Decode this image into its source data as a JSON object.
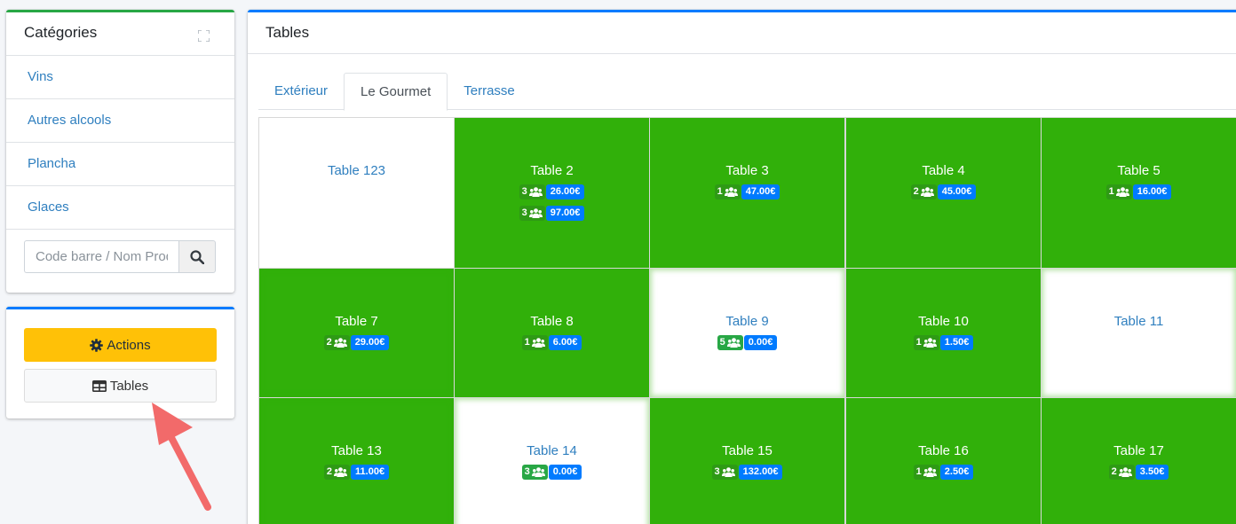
{
  "categories": {
    "title": "Catégories",
    "items": [
      "Vins",
      "Autres alcools",
      "Plancha",
      "Glaces"
    ],
    "search_placeholder": "Code barre / Nom Produit"
  },
  "actions": {
    "actions_label": "Actions",
    "tables_label": "Tables"
  },
  "tables_panel": {
    "title": "Tables",
    "tabs": [
      "Extérieur",
      "Le Gourmet",
      "Terrasse"
    ],
    "active_tab": "Le Gourmet",
    "tables": [
      {
        "name": "Table 123",
        "status": "free",
        "orders": []
      },
      {
        "name": "Table 2",
        "status": "busy",
        "orders": [
          {
            "covers": "3",
            "amount": "26.00€"
          },
          {
            "covers": "3",
            "amount": "97.00€"
          }
        ]
      },
      {
        "name": "Table 3",
        "status": "busy",
        "orders": [
          {
            "covers": "1",
            "amount": "47.00€"
          }
        ]
      },
      {
        "name": "Table 4",
        "status": "busy",
        "orders": [
          {
            "covers": "2",
            "amount": "45.00€"
          }
        ]
      },
      {
        "name": "Table 5",
        "status": "busy",
        "orders": [
          {
            "covers": "1",
            "amount": "16.00€"
          }
        ]
      },
      {
        "name": "Table 7",
        "status": "busy",
        "orders": [
          {
            "covers": "2",
            "amount": "29.00€"
          }
        ]
      },
      {
        "name": "Table 8",
        "status": "busy",
        "orders": [
          {
            "covers": "1",
            "amount": "6.00€"
          }
        ]
      },
      {
        "name": "Table 9",
        "status": "free",
        "orders": [
          {
            "covers": "5",
            "amount": "0.00€"
          }
        ]
      },
      {
        "name": "Table 10",
        "status": "busy",
        "orders": [
          {
            "covers": "1",
            "amount": "1.50€"
          }
        ]
      },
      {
        "name": "Table 11",
        "status": "free",
        "orders": []
      },
      {
        "name": "Table 13",
        "status": "busy",
        "orders": [
          {
            "covers": "2",
            "amount": "11.00€"
          }
        ]
      },
      {
        "name": "Table 14",
        "status": "free",
        "orders": [
          {
            "covers": "3",
            "amount": "0.00€"
          }
        ]
      },
      {
        "name": "Table 15",
        "status": "busy",
        "orders": [
          {
            "covers": "3",
            "amount": "132.00€"
          }
        ]
      },
      {
        "name": "Table 16",
        "status": "busy",
        "orders": [
          {
            "covers": "1",
            "amount": "2.50€"
          }
        ]
      },
      {
        "name": "Table 17",
        "status": "busy",
        "orders": [
          {
            "covers": "2",
            "amount": "3.50€"
          }
        ]
      }
    ]
  },
  "colors": {
    "busy": "#31b00a",
    "amount_badge": "#007bff",
    "actions_button": "#ffc107",
    "link": "#2f7fbf",
    "annotation_arrow": "#f26a6a"
  },
  "icons": {
    "expand": "expand-icon",
    "search": "search-icon",
    "actions": "gear-icon",
    "tables": "table-icon",
    "covers": "users-icon"
  }
}
